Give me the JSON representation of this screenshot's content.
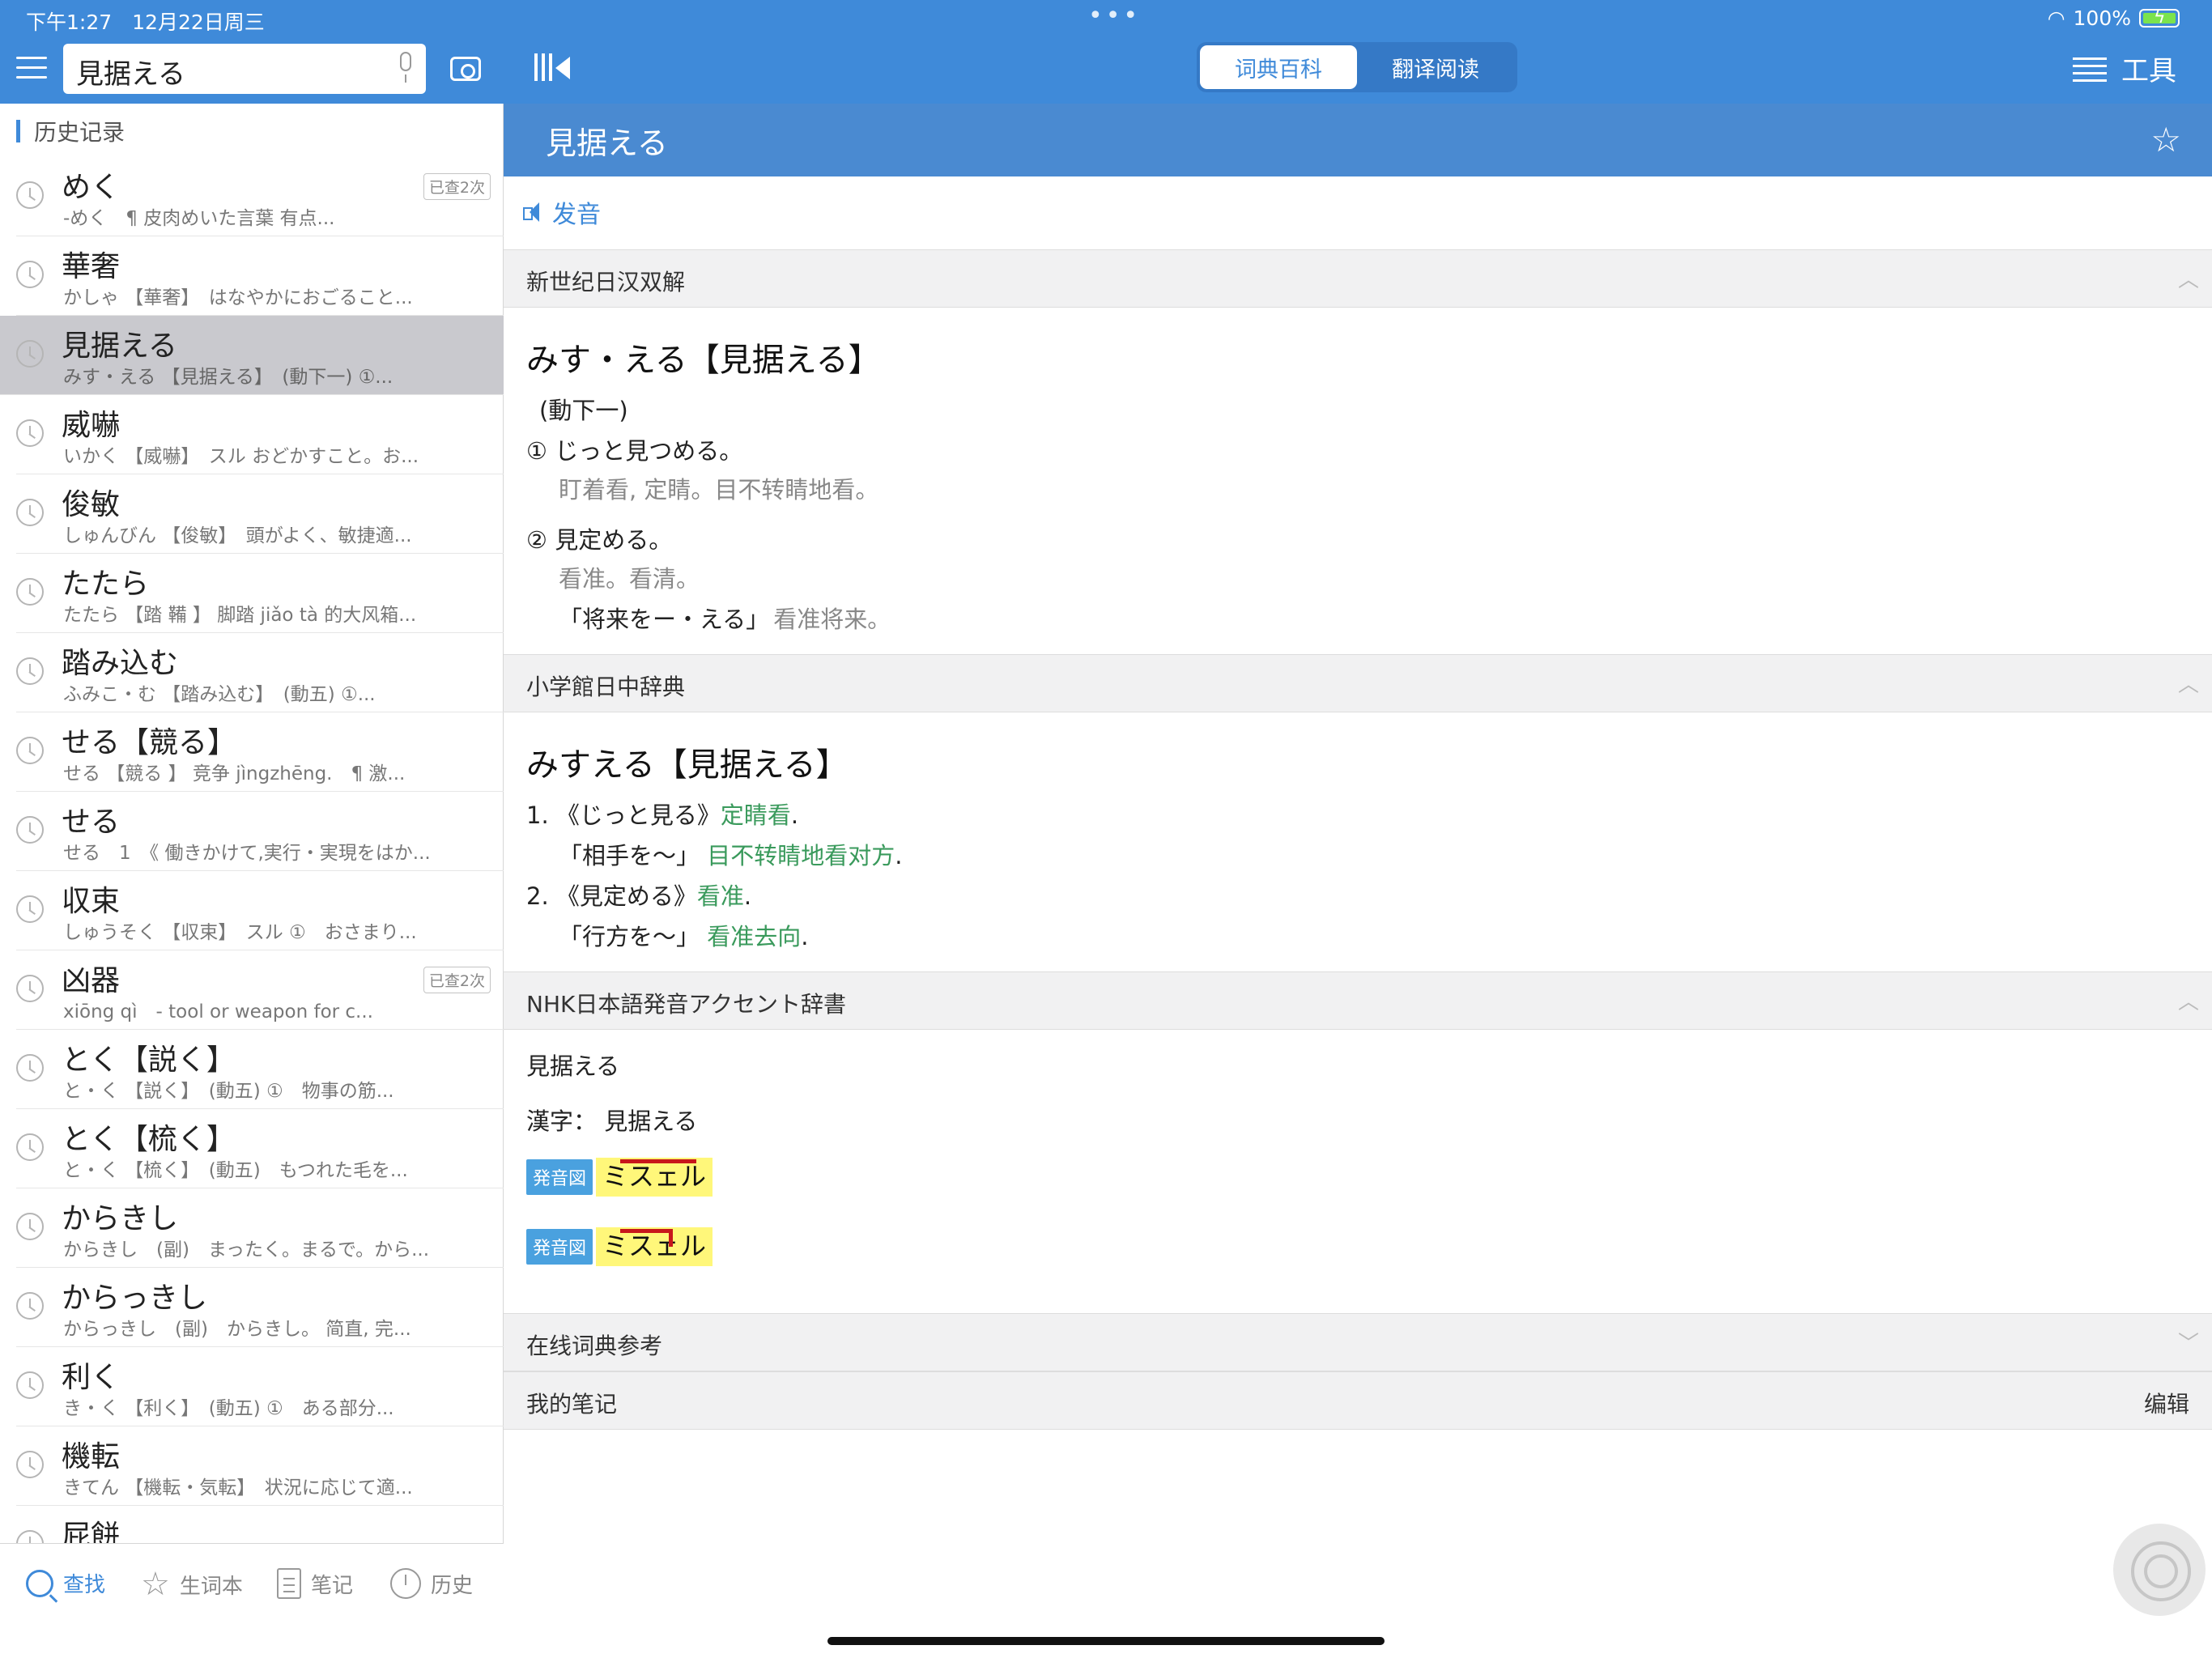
{
  "status": {
    "time": "下午1:27　12月22日周三",
    "battery": "100%"
  },
  "search": {
    "value": "見据える"
  },
  "segment": {
    "tab1": "词典百科",
    "tab2": "翻译阅读"
  },
  "tools": {
    "label": "工具"
  },
  "history": {
    "title": "历史记录",
    "items": [
      {
        "word": "めく",
        "sub": "-めく　¶ 皮肉めいた言葉 有点...",
        "badge": "已查2次"
      },
      {
        "word": "華奢",
        "sub": "かしゃ 【華奢】　はなやかにおごること...",
        "badge": ""
      },
      {
        "word": "見据える",
        "sub": "みす・える 【見据える】　(動下一) ①...",
        "badge": ""
      },
      {
        "word": "威嚇",
        "sub": "いかく 【威嚇】　スル おどかすこと。お...",
        "badge": ""
      },
      {
        "word": "俊敏",
        "sub": "しゅんびん 【俊敏】　頭がよく、敏捷適...",
        "badge": ""
      },
      {
        "word": "たたら",
        "sub": "たたら 【踏 鞴 】 脚踏 jiǎo tà 的大风箱...",
        "badge": ""
      },
      {
        "word": "踏み込む",
        "sub": "ふみこ・む 【踏み込む】　(動五) ①...",
        "badge": ""
      },
      {
        "word": "せる【競る】",
        "sub": "せる 【競る 】 竞争 jìngzhēng.　¶ 激...",
        "badge": ""
      },
      {
        "word": "せる",
        "sub": "せる　1　《 働きかけて,実行・実現をはか...",
        "badge": ""
      },
      {
        "word": "収束",
        "sub": "しゅうそく 【収束】　スル ①　おさまり...",
        "badge": ""
      },
      {
        "word": "凶器",
        "sub": "xiōng qì　- tool or weapon for c...",
        "badge": "已查2次"
      },
      {
        "word": "とく【説く】",
        "sub": "と・く 【説く】　(動五) ①　物事の筋...",
        "badge": ""
      },
      {
        "word": "とく【梳く】",
        "sub": "と・く 【梳く】　(動五)　もつれた毛を...",
        "badge": ""
      },
      {
        "word": "からきし",
        "sub": "からきし　(副)　まったく。まるで。から...",
        "badge": ""
      },
      {
        "word": "からっきし",
        "sub": "からっきし　(副)　からきし。 简直, 完...",
        "badge": ""
      },
      {
        "word": "利く",
        "sub": "き・く 【利く】　(動五) ①　ある部分...",
        "badge": ""
      },
      {
        "word": "機転",
        "sub": "きてん 【機転・気転】　状況に応じて適...",
        "badge": ""
      },
      {
        "word": "屁餅",
        "sub": "",
        "badge": ""
      }
    ]
  },
  "bottom_tabs": {
    "search": "查找",
    "vocab": "生词本",
    "notes": "笔记",
    "history": "历史"
  },
  "entry": {
    "title": "見据える",
    "pronounce": "发音",
    "sec1": {
      "name": "新世纪日汉双解",
      "headword": "みす・える【見据える】",
      "pos": "(動下一)",
      "def1": "① じっと見つめる。",
      "trans1": "盯着看, 定睛。目不转睛地看。",
      "def2": "② 見定める。",
      "trans2": "看准。看清。",
      "ex_jp": "「将来をー・える」",
      "ex_cn": "看准将来。"
    },
    "sec2": {
      "name": "小学館日中辞典",
      "headword": "みすえる【見据える】",
      "n1": "1.",
      "d1_jp": "《じっと見る》",
      "d1_cn": "定睛看",
      "ex1_jp": "「相手を～」",
      "ex1_cn": "目不转睛地看对方",
      "n2": "2.",
      "d2_jp": "《見定める》",
      "d2_cn": "看准",
      "ex2_jp": "「行方を～」",
      "ex2_cn": "看准去向",
      "period": "."
    },
    "sec3": {
      "name": "NHK日本語発音アクセント辞書",
      "word": "見据える",
      "kanji_label": "漢字：",
      "kanji": "見据える",
      "accent_label": "発音図",
      "accent_kana": "ミスェル"
    },
    "sec4": {
      "name": "在线词典参考"
    },
    "sec5": {
      "name": "我的笔记",
      "edit": "编辑"
    }
  },
  "colors": {
    "accent": "#3f8ad9",
    "header": "#4a8ad1",
    "green": "#3a9a5c"
  }
}
